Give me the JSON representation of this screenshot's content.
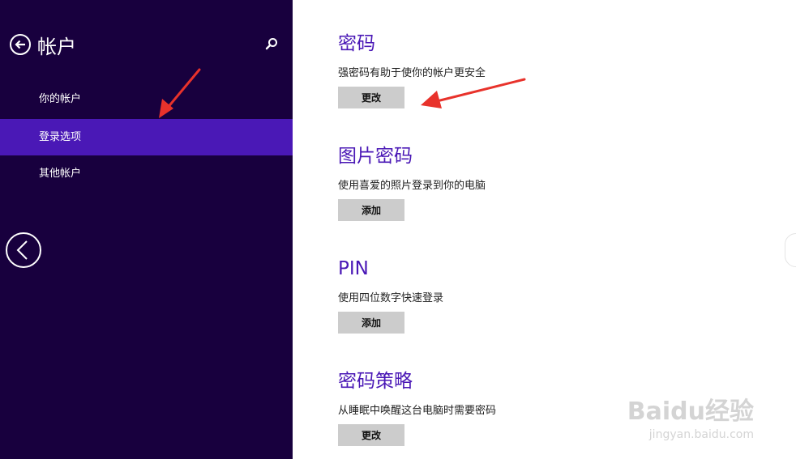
{
  "header": {
    "title": "帐户"
  },
  "sidebar": {
    "items": [
      {
        "label": "你的帐户"
      },
      {
        "label": "登录选项",
        "selected": true
      },
      {
        "label": "其他帐户"
      }
    ]
  },
  "main": {
    "sections": [
      {
        "title": "密码",
        "description": "强密码有助于使你的帐户更安全",
        "button": "更改"
      },
      {
        "title": "图片密码",
        "description": "使用喜爱的照片登录到你的电脑",
        "button": "添加"
      },
      {
        "title": "PIN",
        "description": "使用四位数字快速登录",
        "button": "添加"
      },
      {
        "title": "密码策略",
        "description": "从睡眠中唤醒这台电脑时需要密码",
        "button": "更改"
      }
    ]
  },
  "watermark": {
    "brand": "Baidu经验",
    "site": "jingyan.baidu.com"
  },
  "colors": {
    "sidebar": "#18003e",
    "accent": "#4a18b6",
    "button": "#cccccc",
    "annotation": "#e8322b"
  },
  "icons": [
    "back-arrow-icon",
    "search-icon",
    "chevron-left-icon",
    "annotation-arrow"
  ]
}
